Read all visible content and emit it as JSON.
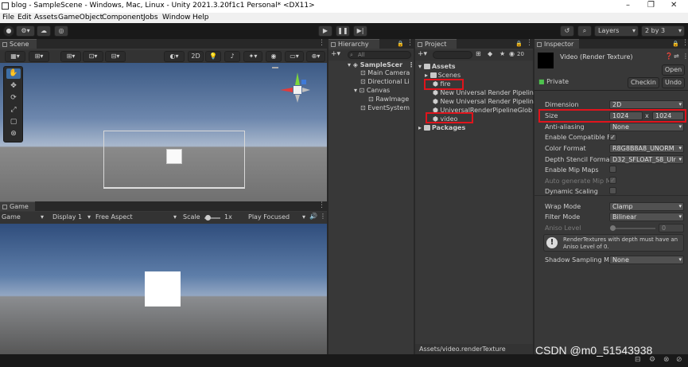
{
  "window": {
    "title": "blog - SampleScene - Windows, Mac, Linux - Unity 2021.3.20f1c1 Personal* <DX11>",
    "controls": [
      "–",
      "❐",
      "✕"
    ]
  },
  "menu": [
    "File",
    "Edit",
    "Assets",
    "GameObject",
    "Component",
    "Jobs",
    "Window",
    "Help"
  ],
  "toolbar": {
    "layers_label": "Layers",
    "layout_label": "2 by 3"
  },
  "scene": {
    "tab_label": "Scene",
    "mode_2d": "2D"
  },
  "game": {
    "tab_label": "Game",
    "view_select": "Game",
    "display_select": "Display 1",
    "aspect_select": "Free Aspect",
    "scale_label": "Scale",
    "scale_value": "1x",
    "play_mode": "Play Focused"
  },
  "hierarchy": {
    "tab_label": "Hierarchy",
    "search_placeholder": "All",
    "items": [
      "SampleScer",
      "Main Camera",
      "Directional Li",
      "Canvas",
      "RawImage",
      "EventSystem"
    ]
  },
  "project": {
    "tab_label": "Project",
    "asset_count": "20",
    "items": [
      "Assets",
      "Scenes",
      "fire",
      "New Universal Render Pipelin",
      "New Universal Render Pipelin",
      "UniversalRenderPipelineGlob",
      "video",
      "Packages"
    ],
    "footer_path": "Assets/video.renderTexture"
  },
  "inspector": {
    "tab_label": "Inspector",
    "asset_title": "Video (Render Texture)",
    "open_button": "Open",
    "private_label": "Private",
    "checkin_button": "Checkin",
    "undo_button": "Undo",
    "rows": {
      "dimension": {
        "label": "Dimension",
        "value": "2D"
      },
      "size": {
        "label": "Size",
        "width": "1024",
        "x": "x",
        "height": "1024"
      },
      "anti_aliasing": {
        "label": "Anti-aliasing",
        "value": "None"
      },
      "enable_compatible": {
        "label": "Enable Compatible F",
        "checked": "✓"
      },
      "color_format": {
        "label": "Color Format",
        "value": "R8G8B8A8_UNORM"
      },
      "depth_stencil": {
        "label": "Depth Stencil Forma",
        "value": "D32_SFLOAT_S8_UIr"
      },
      "enable_mip_maps": {
        "label": "Enable Mip Maps"
      },
      "auto_generate_mip": {
        "label": "Auto generate Mip M",
        "checked": "✓"
      },
      "dynamic_scaling": {
        "label": "Dynamic Scaling"
      },
      "wrap_mode": {
        "label": "Wrap Mode",
        "value": "Clamp"
      },
      "filter_mode": {
        "label": "Filter Mode",
        "value": "Bilinear"
      },
      "aniso_level": {
        "label": "Aniso Level",
        "value": "0"
      },
      "shadow_sampling": {
        "label": "Shadow Sampling M",
        "value": "None"
      }
    },
    "warning": "RenderTextures with depth must have an Aniso Level of 0."
  },
  "watermark": "CSDN @m0_51543938",
  "colors": {
    "highlight_box": "#e0141c",
    "active_tool": "#3d6ea5",
    "panel_bg": "#383838"
  }
}
